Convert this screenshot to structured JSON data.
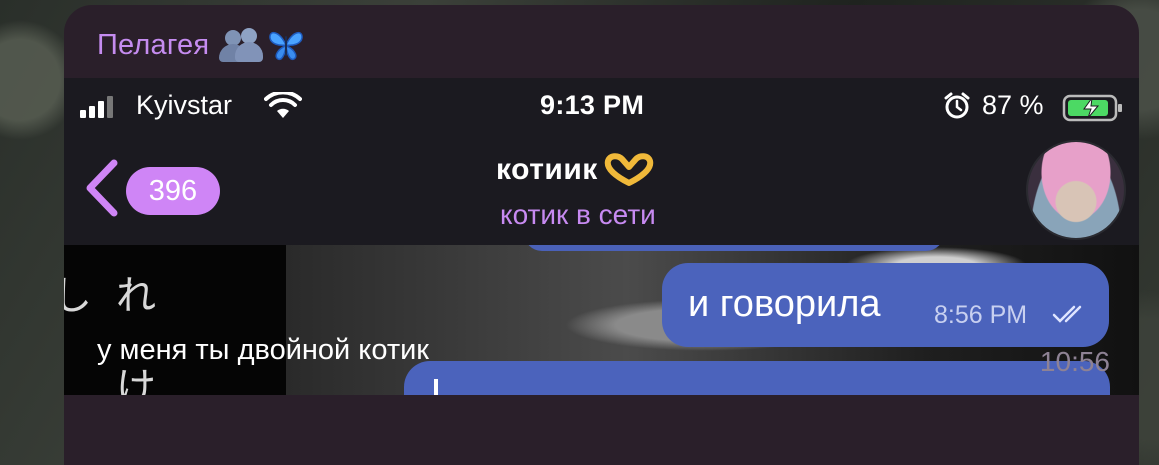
{
  "message": {
    "sender": "Пелагея",
    "caption": "у меня ты двойной котик",
    "time": "10:56"
  },
  "screenshot": {
    "status_bar": {
      "carrier": "Kyivstar",
      "time": "9:13 PM",
      "battery": "87 %"
    },
    "nav": {
      "back_count": "396",
      "contact_name": "котиик",
      "contact_status": "котик в сети"
    },
    "chat": {
      "message_text": "и говорила",
      "message_time": "8:56 PM"
    }
  },
  "colors": {
    "bubble_bg": "#2a1f2a",
    "sender_name": "#c58cf0",
    "accent_purple": "#cf85f6",
    "outgoing_bubble": "#4b63bc"
  },
  "icons": [
    "people-hugging-icon",
    "butterfly-icon",
    "signal-icon",
    "wifi-icon",
    "alarm-icon",
    "battery-charging-icon",
    "back-chevron-icon",
    "heart-hands-icon",
    "double-check-icon"
  ]
}
